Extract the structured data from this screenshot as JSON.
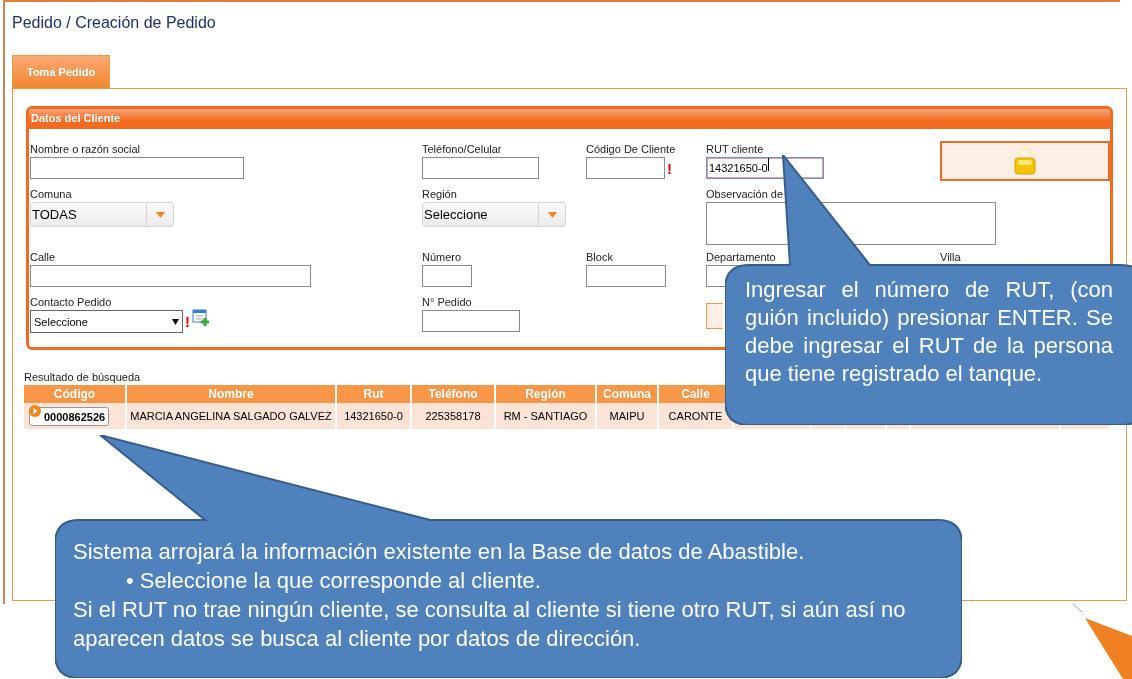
{
  "page": {
    "title": "Pedido / Creación de Pedido"
  },
  "tabs": [
    {
      "label": "Toma Pedido",
      "selected": true
    }
  ],
  "client_panel": {
    "title": "Datos del Cliente",
    "fields": [
      {
        "kind": "text",
        "label": "Nombre o razón social",
        "focused": false
      },
      {
        "kind": "text",
        "label": "Teléfono/Celular",
        "focused": false
      },
      {
        "kind": "text",
        "label": "Código De Cliente",
        "required_mark": "!",
        "focused": false
      },
      {
        "kind": "text",
        "label": "RUT cliente",
        "value": "14321650-0",
        "focused": true
      },
      {
        "kind": "lock"
      },
      {
        "kind": "dropdown",
        "label": "Comuna",
        "value": "TODAS"
      },
      {
        "kind": "dropdown",
        "label": "Región",
        "value": "Seleccione"
      },
      {
        "kind": "textarea",
        "label": "Observación de"
      },
      {
        "kind": "text",
        "label": "Calle",
        "focused": false
      },
      {
        "kind": "text",
        "label": "Número",
        "focused": false
      },
      {
        "kind": "text",
        "label": "Block",
        "focused": false
      },
      {
        "kind": "text",
        "label": "Departamento",
        "focused": false
      },
      {
        "kind": "text",
        "label": "Villa"
      },
      {
        "kind": "select",
        "label": "Contacto Pedido",
        "value": "Seleccione",
        "required_mark": "!"
      },
      {
        "kind": "text",
        "label": "N° Pedido",
        "focused": false
      },
      {
        "kind": "button"
      }
    ]
  },
  "results": {
    "label": "Resultado de búsqueda",
    "columns": [
      "Código",
      "Nombre",
      "Rut",
      "Teléfono",
      "Región",
      "Comuna",
      "Calle"
    ],
    "rows": [
      {
        "cells": [
          "0000862526",
          "MARCIA ANGELINA SALGADO GALVEZ",
          "14321650-0",
          "225358178",
          "RM - SANTIAGO",
          "MAIPU",
          "CARONTE"
        ]
      }
    ]
  },
  "callouts": [
    {
      "paragraphs": [
        {
          "kind": "text",
          "text": "Ingresar el número de RUT, (con guión incluido)  presionar ENTER. Se debe ingresar el RUT de la persona que tiene registrado el tanque."
        }
      ]
    },
    {
      "paragraphs": [
        {
          "kind": "text",
          "text": "Sistema arrojará la información existente en la Base de datos de Abastible."
        },
        {
          "kind": "bullet",
          "text": "• Seleccione la que corresponde al cliente."
        },
        {
          "kind": "text",
          "text": "Si el RUT no trae ningún cliente, se consulta al cliente si tiene otro RUT, si aún así no aparecen datos se busca al cliente por datos de dirección."
        }
      ]
    }
  ]
}
